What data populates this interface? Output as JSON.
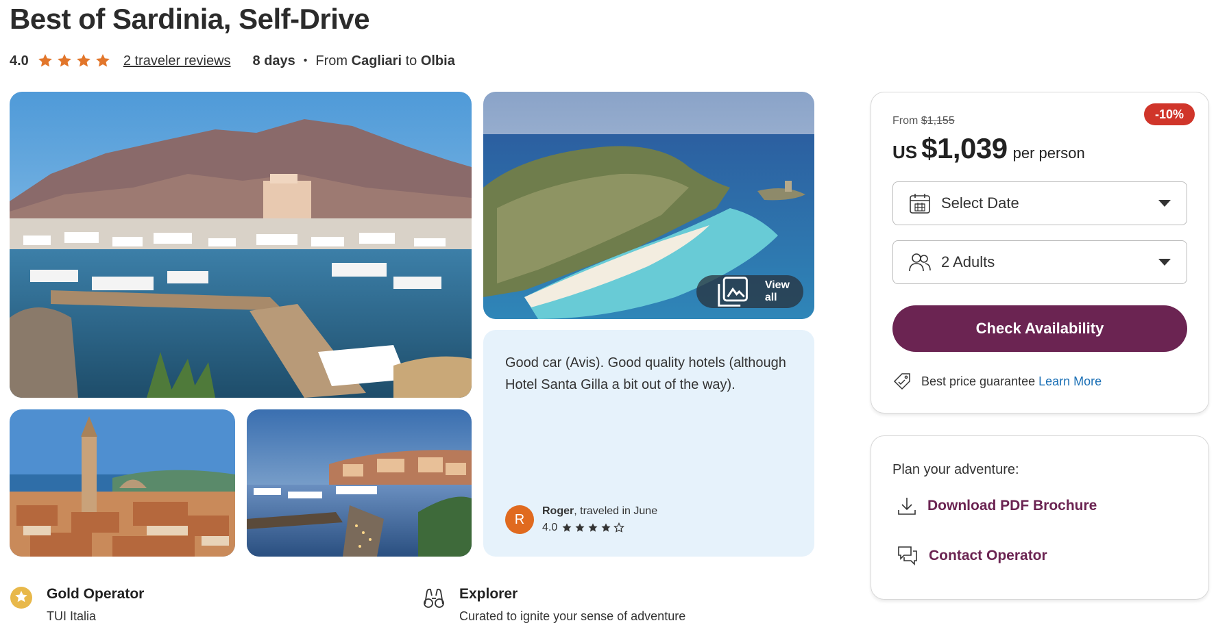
{
  "tour": {
    "title": "Best of Sardinia, Self-Drive",
    "rating": "4.0",
    "reviews_link": "2 traveler reviews",
    "duration": "8 days",
    "from_label": "From",
    "start_city": "Cagliari",
    "to_label": "to",
    "end_city": "Olbia"
  },
  "gallery": {
    "view_all_label": "View all"
  },
  "review": {
    "text": "Good car (Avis). Good quality hotels (although Hotel Santa Gilla a bit out of the way).",
    "avatar_initial": "R",
    "reviewer_name": "Roger",
    "reviewer_suffix": ", traveled in June",
    "rating": "4.0",
    "stars_filled": 4,
    "stars_total": 5
  },
  "features": [
    {
      "title": "Gold Operator",
      "subtitle": "TUI Italia",
      "icon": "gold-star-badge-icon"
    },
    {
      "title": "Explorer",
      "subtitle": "Curated to ignite your sense of adventure",
      "icon": "binoculars-icon"
    }
  ],
  "booking": {
    "discount_badge": "-10%",
    "from_label": "From",
    "old_price": "$1,155",
    "currency": "US",
    "price": "$1,039",
    "per_person": "per person",
    "date_select": "Select Date",
    "guests_select": "2 Adults",
    "check_button": "Check Availability",
    "guarantee_text": "Best price guarantee",
    "learn_more": "Learn More"
  },
  "plan": {
    "title": "Plan your adventure:",
    "download_label": "Download PDF Brochure",
    "contact_label": "Contact Operator"
  },
  "colors": {
    "star": "#e2762b",
    "primary": "#6b2452",
    "discount": "#d0352a",
    "link": "#1a6fb5",
    "review_bg": "#e6f2fb"
  }
}
